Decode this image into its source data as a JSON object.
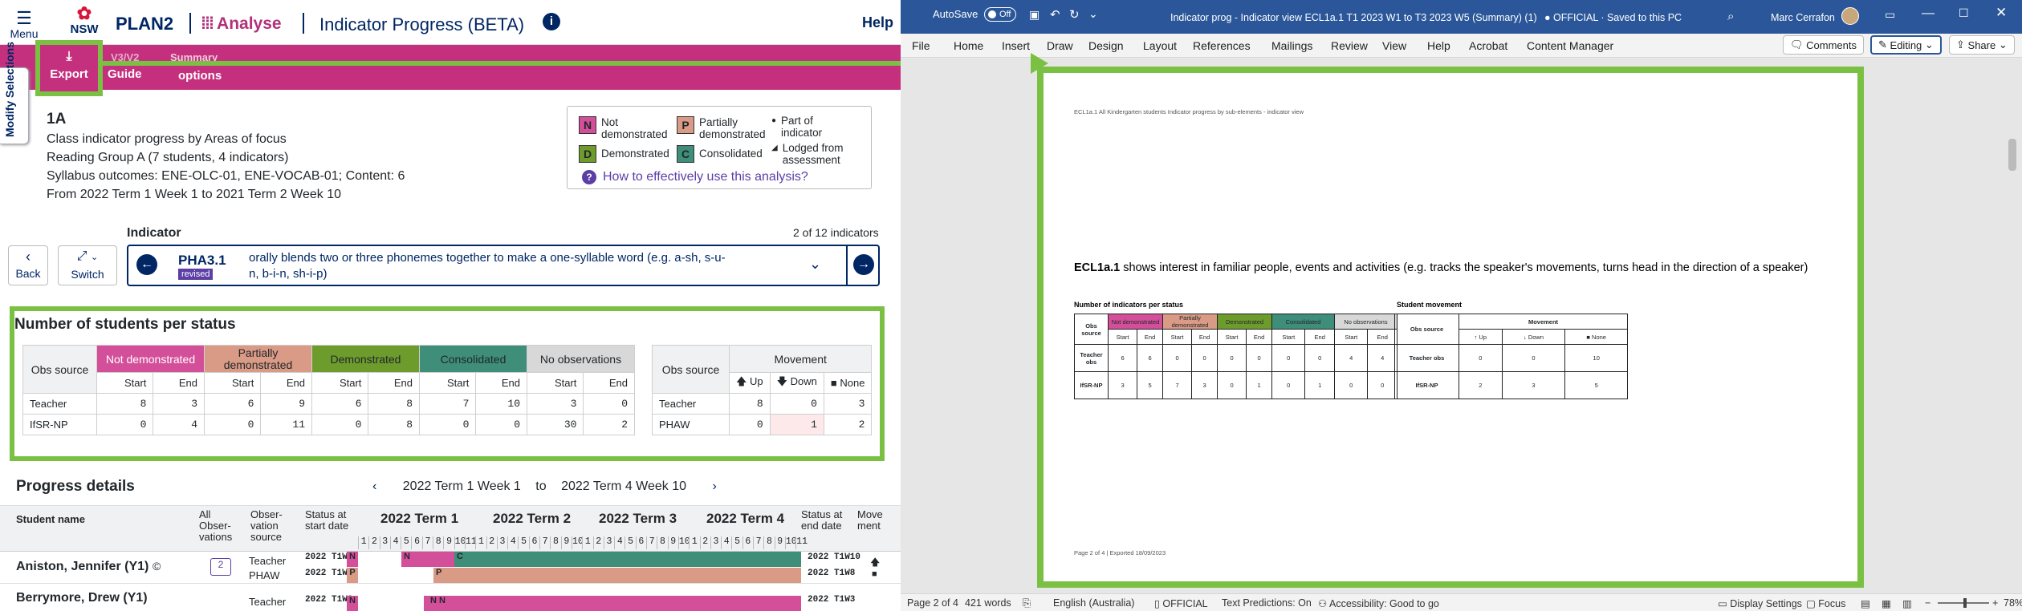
{
  "app": {
    "menu_label": "Menu",
    "logo_text": "NSW",
    "product": "PLAN2",
    "module": "Analyse",
    "page_title": "Indicator Progress (BETA)",
    "help_label": "Help"
  },
  "pinkbar": {
    "export_label": "Export",
    "guide_label": "Guide",
    "v3v2_label": "V3/V2",
    "summary_label": "Summary",
    "options_label": "options",
    "modify_label": "Modify Selections"
  },
  "class_info": {
    "heading": "1A",
    "line1": "Class indicator progress by Areas of focus",
    "line2": "Reading Group A  (7 students, 4 indicators)",
    "line3": "Syllabus outcomes: ENE-OLC-01, ENE-VOCAB-01; Content: 6",
    "line4": "From 2022 Term 1 Week 1 to  2021 Term 2 Week 10"
  },
  "legend": {
    "n": {
      "code": "N",
      "label": "Not demonstrated",
      "color": "#d44f99"
    },
    "p": {
      "code": "P",
      "label": "Partially demonstrated",
      "color": "#d99a86"
    },
    "d": {
      "code": "D",
      "label": "Demonstrated",
      "color": "#6d9c2d"
    },
    "c": {
      "code": "C",
      "label": "Consolidated",
      "color": "#3e8e79"
    },
    "dot_label": "Part of indicator",
    "tri_label": "Lodged from assessment",
    "how_link": "How to effectively use this analysis?"
  },
  "nav": {
    "back_label": "Back",
    "switch_label": "Switch"
  },
  "indicator": {
    "label": "Indicator",
    "count": "2 of 12 indicators",
    "code": "PHA3.1",
    "badge": "revised",
    "text": "orally blends two or three phonemes together to make a one-syllable word (e.g. a-sh, s-u-n, b-i-n, sh-i-p)"
  },
  "status_table": {
    "title": "Number of students per status",
    "obs_source_label": "Obs source",
    "cols": [
      "Not demonstrated",
      "Partially demonstrated",
      "Demonstrated",
      "Consolidated",
      "No observations"
    ],
    "start_label": "Start",
    "end_label": "End",
    "rows": [
      {
        "source": "Teacher",
        "values": [
          "8",
          "3",
          "6",
          "9",
          "6",
          "8",
          "7",
          "10",
          "3",
          "0"
        ]
      },
      {
        "source": "IfSR-NP",
        "values": [
          "0",
          "4",
          "0",
          "11",
          "0",
          "8",
          "0",
          "0",
          "30",
          "2"
        ]
      }
    ]
  },
  "movement_table": {
    "obs_source_label": "Obs source",
    "title": "Movement",
    "up_label": "Up",
    "down_label": "Down",
    "none_label": "None",
    "rows": [
      {
        "source": "Teacher",
        "values": [
          "8",
          "0",
          "3"
        ]
      },
      {
        "source": "PHAW",
        "values": [
          "0",
          "1",
          "2"
        ]
      }
    ]
  },
  "progress": {
    "title": "Progress details",
    "range_from": "2022 Term 1 Week 1",
    "range_to_label": "to",
    "range_to": "2022 Term 4 Week 10",
    "h_student": "Student name",
    "h_all_obs": "All Obser-vations",
    "h_obs_source": "Obser-vation source",
    "h_status_start": "Status at start date",
    "h_status_end": "Status at end date",
    "h_movement": "Move ment",
    "terms": [
      "2022 Term 1",
      "2022 Term 2",
      "2022 Term 3",
      "2022 Term 4"
    ],
    "weeks": [
      "1",
      "2",
      "3",
      "4",
      "5",
      "6",
      "7",
      "8",
      "9",
      "10",
      "11",
      "1",
      "2",
      "3",
      "4",
      "5",
      "6",
      "7",
      "8",
      "9",
      "10",
      "1",
      "2",
      "3",
      "4",
      "5",
      "6",
      "7",
      "8",
      "9",
      "10",
      "1",
      "2",
      "3",
      "4",
      "5",
      "6",
      "7",
      "8",
      "9",
      "10",
      "11"
    ],
    "students": [
      {
        "name": "Aniston, Jennifer (Y1)",
        "sources": [
          "Teacher",
          "PHAW"
        ],
        "start_dates": [
          "2022 T1W5",
          "2022 T1W8"
        ],
        "end_dates": [
          "2022 T1W10",
          "2022 T1W8"
        ],
        "start_status": [
          "N",
          "P"
        ],
        "mid_labels": [
          "N",
          "P"
        ],
        "end_status": [
          "C",
          "P"
        ]
      },
      {
        "name": "Berrymore, Drew (Y1)",
        "sources": [
          "Teacher"
        ],
        "start_dates": [
          "2022 T1W2"
        ],
        "end_dates": [
          "2022 T1W3"
        ],
        "start_status": [
          "N"
        ],
        "mid_labels": [
          "N N"
        ],
        "end_status": [
          "N"
        ]
      }
    ]
  },
  "word": {
    "autosave_label": "AutoSave",
    "autosave_state": "Off",
    "doc_title": "Indicator prog - Indicator view ECL1a.1 T1 2023 W1 to T3 2023 W5 (Summary) (1)",
    "official_label": "OFFICIAL",
    "saved_label": "Saved to this PC",
    "user": "Marc Cerrafon",
    "tabs": [
      "File",
      "Home",
      "Insert",
      "Draw",
      "Design",
      "Layout",
      "References",
      "Mailings",
      "Review",
      "View",
      "Help",
      "Acrobat",
      "Content Manager"
    ],
    "comments_label": "Comments",
    "editing_label": "Editing",
    "share_label": "Share",
    "doc_header_small": "ECL1a.1 All Kindergarten students Indicator progress by sub-elements - indicator view",
    "doc_heading_code": "ECL1a.1",
    "doc_heading_text": "shows interest in familiar people, events and activities (e.g. tracks the speaker's movements, turns head in the direction of a speaker)",
    "doc_sub1": "Number of indicators per status",
    "doc_sub2": "Student movement",
    "doc_obs": "Obs source",
    "doc_cols": [
      "Not demonstrated",
      "Partially demonstrated",
      "Demonstrated",
      "Consolidated",
      "No observations"
    ],
    "doc_start": "Start",
    "doc_end": "End",
    "doc_rows": [
      {
        "source": "Teacher obs",
        "values": [
          "6",
          "6",
          "0",
          "0",
          "0",
          "0",
          "0",
          "0",
          "4",
          "4"
        ],
        "mv": [
          "0",
          "0",
          "10"
        ]
      },
      {
        "source": "IfSR-NP",
        "values": [
          "3",
          "5",
          "7",
          "3",
          "0",
          "1",
          "0",
          "1",
          "0",
          "0"
        ],
        "mv": [
          "2",
          "3",
          "5"
        ]
      }
    ],
    "doc_movement": "Movement",
    "doc_up": "↑ Up",
    "doc_down": "↓ Down",
    "doc_none": "■ None",
    "doc_footer": "Page 2 of 4 | Exported 18/09/2023",
    "status_page": "Page 2 of 4",
    "status_words": "421 words",
    "status_lang": "English (Australia)",
    "status_official": "OFFICIAL",
    "status_predictions": "Text Predictions: On",
    "status_access": "Accessibility: Good to go",
    "status_display": "Display Settings",
    "status_focus": "Focus",
    "status_zoom": "78%"
  }
}
